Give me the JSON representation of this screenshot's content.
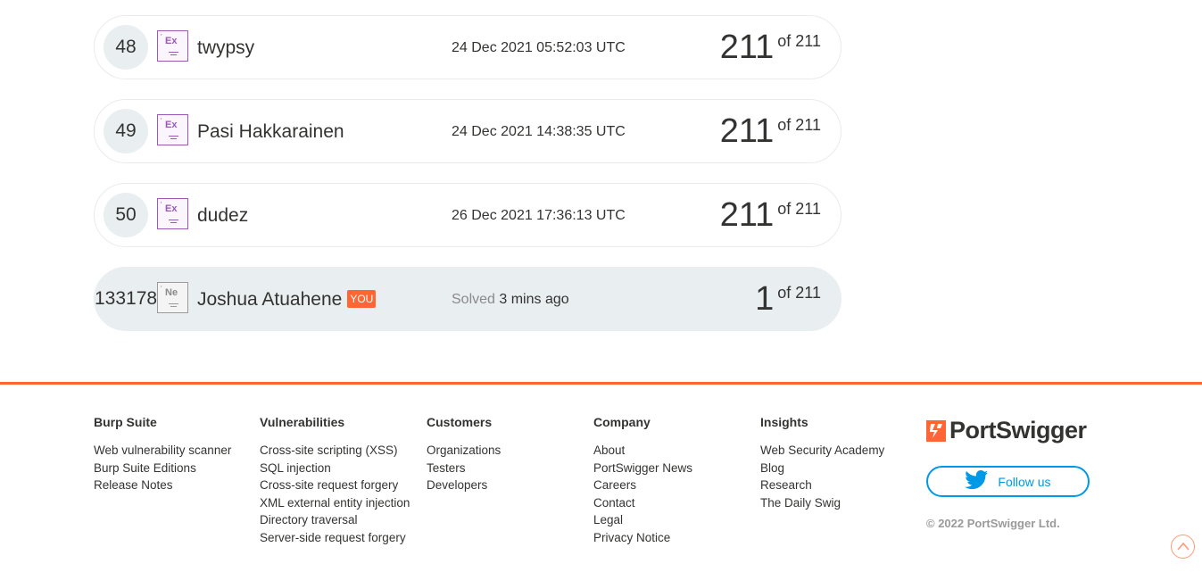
{
  "leaderboard": {
    "rows": [
      {
        "rank": "48",
        "symbol": "Ex",
        "name": "twypsy",
        "time": "24 Dec 2021 05:52:03 UTC",
        "score": "211",
        "of": "of 211"
      },
      {
        "rank": "49",
        "symbol": "Ex",
        "name": "Pasi Hakkarainen",
        "time": "24 Dec 2021 14:38:35 UTC",
        "score": "211",
        "of": "of 211"
      },
      {
        "rank": "50",
        "symbol": "Ex",
        "name": "dudez",
        "time": "26 Dec 2021 17:36:13 UTC",
        "score": "211",
        "of": "of 211"
      }
    ],
    "me": {
      "rank": "133178",
      "symbol": "Ne",
      "name": "Joshua Atuahene",
      "badge": "YOU",
      "solved_label": "Solved",
      "solved_time": "3 mins ago",
      "score": "1",
      "of": "of 211"
    }
  },
  "footer": {
    "columns": [
      {
        "heading": "Burp Suite",
        "links": [
          "Web vulnerability scanner",
          "Burp Suite Editions",
          "Release Notes"
        ]
      },
      {
        "heading": "Vulnerabilities",
        "links": [
          "Cross-site scripting (XSS)",
          "SQL injection",
          "Cross-site request forgery",
          "XML external entity injection",
          "Directory traversal",
          "Server-side request forgery"
        ]
      },
      {
        "heading": "Customers",
        "links": [
          "Organizations",
          "Testers",
          "Developers"
        ]
      },
      {
        "heading": "Company",
        "links": [
          "About",
          "PortSwigger News",
          "Careers",
          "Contact",
          "Legal",
          "Privacy Notice"
        ]
      },
      {
        "heading": "Insights",
        "links": [
          "Web Security Academy",
          "Blog",
          "Research",
          "The Daily Swig"
        ]
      }
    ],
    "brand": "PortSwigger",
    "follow_label": "Follow us",
    "copyright": "© 2022 PortSwigger Ltd."
  },
  "colors": {
    "accent": "#ff6633",
    "twitter": "#0099e5",
    "level_purple": "#9b59b6",
    "row_highlight": "#e9eef1"
  },
  "icons": {
    "level": "element-tile-icon",
    "brand": "portswigger-logo-icon",
    "follow": "twitter-bird-icon",
    "scroll_top": "chevron-up-icon"
  }
}
